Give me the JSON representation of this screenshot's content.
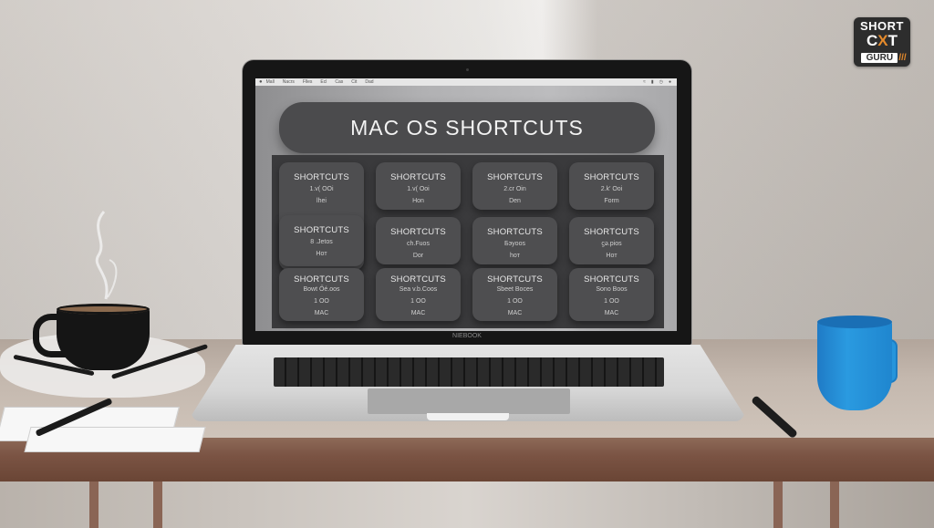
{
  "logo": {
    "line1": "SHORT",
    "line2_a": "C",
    "line2_x": "X",
    "line2_b": "T",
    "line3": "GURU",
    "slashes": "///"
  },
  "screen": {
    "menubar": {
      "apple_icon": "apple-icon",
      "items": [
        "Mall",
        "Nacrs",
        "Flles",
        "Ecl",
        "Cas",
        "Cit",
        "Dad"
      ],
      "status_items": [
        "wifi-icon",
        "battery-icon",
        "clock-icon",
        "user-icon"
      ]
    },
    "title": "MAC OS SHORTCUTS",
    "cards": [
      {
        "title": "SHORTCUTS",
        "lines": [
          "1.v( OOi",
          "lhei"
        ]
      },
      {
        "title": "SHORTCUTS",
        "lines": [
          "1.v( Ooi",
          "Hon"
        ]
      },
      {
        "title": "SHORTCUTS",
        "lines": [
          "2.cr Oin",
          "Den"
        ]
      },
      {
        "title": "SHORTCUTS",
        "lines": [
          "2.k' Ooi",
          "Form"
        ]
      },
      {
        "title": "SHORTCUTS",
        "lines": [
          "8 .Jetos",
          "Hoт"
        ]
      },
      {
        "title": "SHORTCUTS",
        "lines": [
          "ch.Fuos",
          "Dor"
        ]
      },
      {
        "title": "SHORTCUTS",
        "lines": [
          "Бэyoos",
          "hoт"
        ]
      },
      {
        "title": "SHORTCUTS",
        "lines": [
          "ϛə.pios",
          "Hoт"
        ]
      },
      {
        "title": "SHORTCUTS",
        "lines": [
          "Bowt Őé.oos",
          "1 OO",
          "MAC"
        ]
      },
      {
        "title": "SHORTCUTS",
        "lines": [
          "Sea v.b.Coos",
          "1 OO",
          "MAC"
        ]
      },
      {
        "title": "SHORTCUTS",
        "lines": [
          "Sbeet Boces",
          "1 OO",
          "MAC"
        ]
      },
      {
        "title": "SHORTCUTS",
        "lines": [
          "Sono Boos",
          "1 OO",
          "MAC"
        ]
      }
    ]
  },
  "laptop": {
    "brand": "NIEBOOK"
  },
  "colors": {
    "pill": "#4b4b4d",
    "card": "#4e4e50",
    "logo_accent": "#e58a2b",
    "mug": "#2a9ae0",
    "desk_edge": "#7b5444"
  }
}
